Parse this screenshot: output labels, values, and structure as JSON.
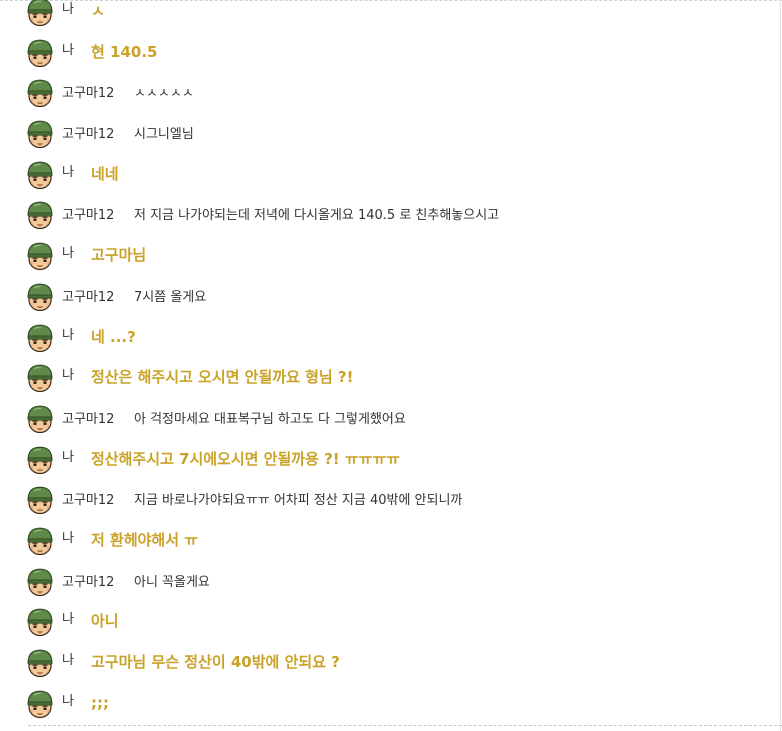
{
  "messages": [
    {
      "sender": "나",
      "text": "ㅅ",
      "self": true
    },
    {
      "sender": "나",
      "text": "현 140.5",
      "self": true
    },
    {
      "sender": "고구마12",
      "text": "ㅅㅅㅅㅅㅅ",
      "self": false
    },
    {
      "sender": "고구마12",
      "text": "시그니엘님",
      "self": false
    },
    {
      "sender": "나",
      "text": "네네",
      "self": true
    },
    {
      "sender": "고구마12",
      "text": "저 지금 나가야되는데 저녁에 다시올게요 140.5 로 친추해놓으시고",
      "self": false
    },
    {
      "sender": "나",
      "text": "고구마님",
      "self": true
    },
    {
      "sender": "고구마12",
      "text": "7시쯤 올게요",
      "self": false
    },
    {
      "sender": "나",
      "text": "네 ...?",
      "self": true
    },
    {
      "sender": "나",
      "text": "정산은 해주시고 오시면 안될까요 형님 ?!",
      "self": true
    },
    {
      "sender": "고구마12",
      "text": "아 걱정마세요 대표복구님 하고도 다 그렇게했어요",
      "self": false
    },
    {
      "sender": "나",
      "text": "정산해주시고 7시에오시면 안될까용 ?! ㅠㅠㅠㅠ",
      "self": true
    },
    {
      "sender": "고구마12",
      "text": "지금 바로나가야되요ㅠㅠ 어차피 정산 지금 40밖에 안되니까",
      "self": false
    },
    {
      "sender": "나",
      "text": "저 환헤야해서 ㅠ",
      "self": true
    },
    {
      "sender": "고구마12",
      "text": "아니 꼭올게요",
      "self": false
    },
    {
      "sender": "나",
      "text": "아니",
      "self": true
    },
    {
      "sender": "나",
      "text": "고구마님 무슨 정산이 40밖에 안되요 ?",
      "self": true
    },
    {
      "sender": "나",
      "text": ";;;",
      "self": true
    }
  ]
}
